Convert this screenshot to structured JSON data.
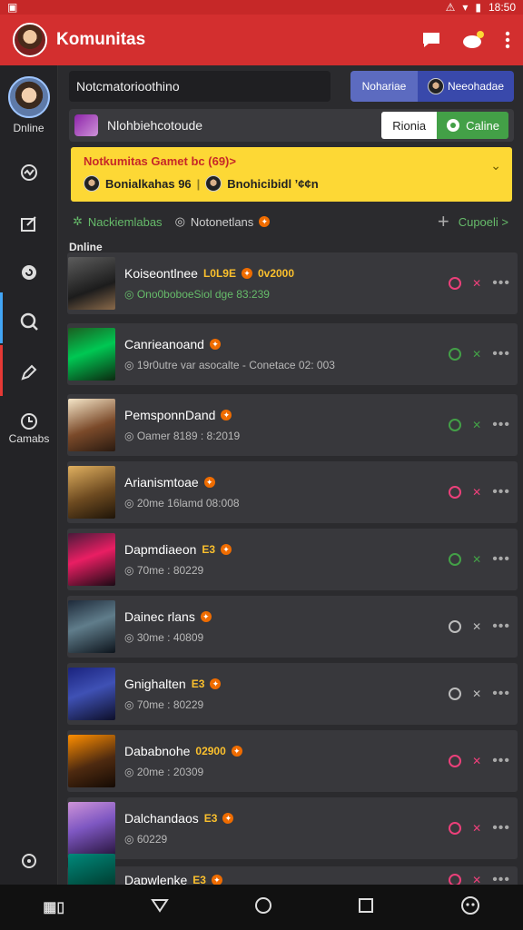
{
  "status_bar": {
    "time": "18:50"
  },
  "header": {
    "title": "Komunitas"
  },
  "sidebar": {
    "status_label": "Dnline",
    "bottom_label": "Camabs"
  },
  "search": {
    "text": "Notcmatorioothino"
  },
  "toggle": {
    "left": "Nohariae",
    "right": "Neeohadae"
  },
  "community": {
    "name": "Nlohbiehcotoude",
    "button_primary": "Rionia",
    "button_secondary": "Caline"
  },
  "notice": {
    "title": "Notkumitas Gamet bc (69)>",
    "user1": "Bonialkahas 96",
    "user2": "Bnohicibidl ’¢¢n"
  },
  "tabs": {
    "tab1": "Nackiemlabas",
    "tab2": "Notonetlans",
    "link": "Cupoeli >"
  },
  "section_label": "Dnline",
  "members": [
    {
      "name": "Koiseontlnee",
      "badge": "L0L9E",
      "extra": "0v2000",
      "sub": "Ono0boboeSiol dge 83:239",
      "sub_green": true,
      "status_color": "#ec407a",
      "thumb": "linear-gradient(160deg,#5d5d5d,#1c1c1c 60%,#8a6a4a)"
    },
    {
      "name": "Canrieanoand",
      "badge": "",
      "extra": "",
      "sub": "19r0utre var asocalte - Conetace 02: 003",
      "sub_green": false,
      "status_color": "#43a047",
      "thumb": "linear-gradient(160deg,#1b5e20,#00c853 45%,#0b2a10)"
    },
    {
      "name": "PemsponnDand",
      "badge": "",
      "extra": "",
      "sub": "Oamer 8189 : 8:2019",
      "sub_green": false,
      "status_color": "#43a047",
      "thumb": "linear-gradient(160deg,#f5e6c8,#7b4a2a 55%,#2a1a10)"
    },
    {
      "name": "Arianismtoae",
      "badge": "",
      "extra": "",
      "sub": "20me 16lamd 08:008",
      "sub_green": false,
      "status_color": "#ec407a",
      "thumb": "linear-gradient(160deg,#e0b060,#6d4a20 55%,#1e1408)"
    },
    {
      "name": "Dapmdiaeon",
      "badge": "E3",
      "extra": "",
      "sub": "70me : 80229",
      "sub_green": false,
      "status_color": "#43a047",
      "thumb": "linear-gradient(160deg,#4a1a3a,#e91e63 45%,#1a0a14)"
    },
    {
      "name": "Dainec rlans",
      "badge": "",
      "extra": "",
      "sub": "30me : 40809",
      "sub_green": false,
      "status_color": "#bdbdbd",
      "thumb": "linear-gradient(160deg,#1e2a3a,#607d8b 45%,#0d141c)"
    },
    {
      "name": "Gnighalten",
      "badge": "E3",
      "extra": "",
      "sub": "70me : 80229",
      "sub_green": false,
      "status_color": "#bdbdbd",
      "thumb": "linear-gradient(160deg,#1a237e,#3f51b5 45%,#0d0f2a)"
    },
    {
      "name": "Dababnohe",
      "badge": "02900",
      "extra": "",
      "sub": "20me : 20309",
      "sub_green": false,
      "status_color": "#ec407a",
      "thumb": "linear-gradient(160deg,#ff8f00,#4e2a10 55%,#140a04)"
    },
    {
      "name": "Dalchandaos",
      "badge": "E3",
      "extra": "",
      "sub": "60229",
      "sub_green": false,
      "status_color": "#ec407a",
      "thumb": "linear-gradient(160deg,#ce93d8,#7e57c2 45%,#2a1640)"
    },
    {
      "name": "Dapwlenke",
      "badge": "E3",
      "extra": "",
      "sub": "",
      "sub_green": false,
      "status_color": "#ec407a",
      "thumb": "linear-gradient(160deg,#00897b,#004d40 55%,#0a1a16)"
    }
  ],
  "colors": {
    "appbar": "#d32f2f",
    "accent_green": "#43a047",
    "notice_yellow": "#fdd835"
  }
}
